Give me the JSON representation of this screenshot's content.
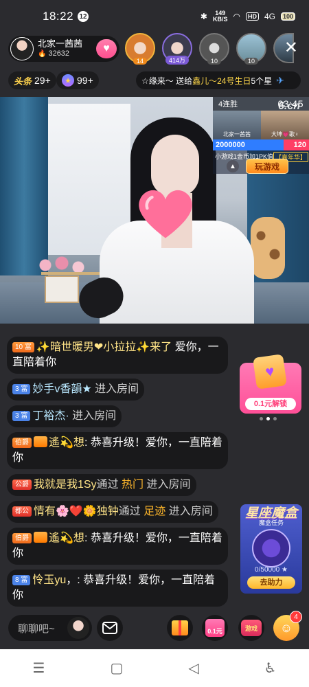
{
  "status_bar": {
    "time": "18:22",
    "notification_count": "12",
    "net_speed": "149",
    "net_unit": "KB/S",
    "hd": "HD",
    "signal": "4G",
    "battery": "100"
  },
  "host": {
    "name": "北家一茜茜",
    "fans": "32632"
  },
  "viewers": [
    {
      "tag": "14"
    },
    {
      "tag": "414万"
    },
    {
      "tag": "10"
    },
    {
      "tag": "10"
    }
  ],
  "ranks": {
    "hot_logo": "头条",
    "hot_count": "29+",
    "star_count": "99+"
  },
  "marquee": {
    "prefix": "☆缘来～ 送给 ",
    "highlight": "鑫儿～24号生日",
    "suffix": " 5个星"
  },
  "pk": {
    "streak": "4连胜",
    "time": "03:45",
    "left_name": "北家一茜茜",
    "right_name": "大坤💗歌♀",
    "left_score": "2000000",
    "right_score": "120",
    "footer": "小游戏1金币加1PK值",
    "footer_tag": "【嘉年华】",
    "play_button": "玩游戏",
    "watermark": "6.cn"
  },
  "chat": [
    {
      "level": "10 富",
      "user": "✨暗世暖男❤小拉拉✨来了",
      "text": " 爱你，一直陪着你"
    },
    {
      "level": "3 富",
      "user": "妙手v香韻★",
      "text": " 进入房间"
    },
    {
      "level": "3 富",
      "user": "丁裕杰·",
      "text": " 进入房间"
    },
    {
      "badge": "伯爵",
      "user": "遙💫想",
      "text": ": 恭喜升级！爱你，一直陪着你"
    },
    {
      "badge": "公爵",
      "user": "我就是我1Sy",
      "via": "通过 ",
      "source": "热门",
      "text": " 进入房间"
    },
    {
      "badge": "都公",
      "user": "情有🌸❤️🌼独钟",
      "via": "通过 ",
      "source": "足迹",
      "text": " 进入房间"
    },
    {
      "badge": "伯爵",
      "user": "遙💫想",
      "text": ": 恭喜升级！爱你，一直陪着你"
    },
    {
      "level": "8 富",
      "user": "怜玉yu",
      "text": "，: 恭喜升级！爱你，一直陪着你"
    }
  ],
  "unlock_card": {
    "label": "0.1元解锁"
  },
  "zodiac": {
    "title": "星座魔盒",
    "task": "魔盒任务",
    "progress": "0/50000 ★",
    "button": "去助力"
  },
  "bottom": {
    "input_placeholder": "聊聊吧~",
    "coupon_label": "0.1元",
    "game_label": "游戏",
    "notif_count": "4"
  },
  "nav": {
    "menu": "☰",
    "home": "▢",
    "back": "◁",
    "accessibility": "♿"
  }
}
